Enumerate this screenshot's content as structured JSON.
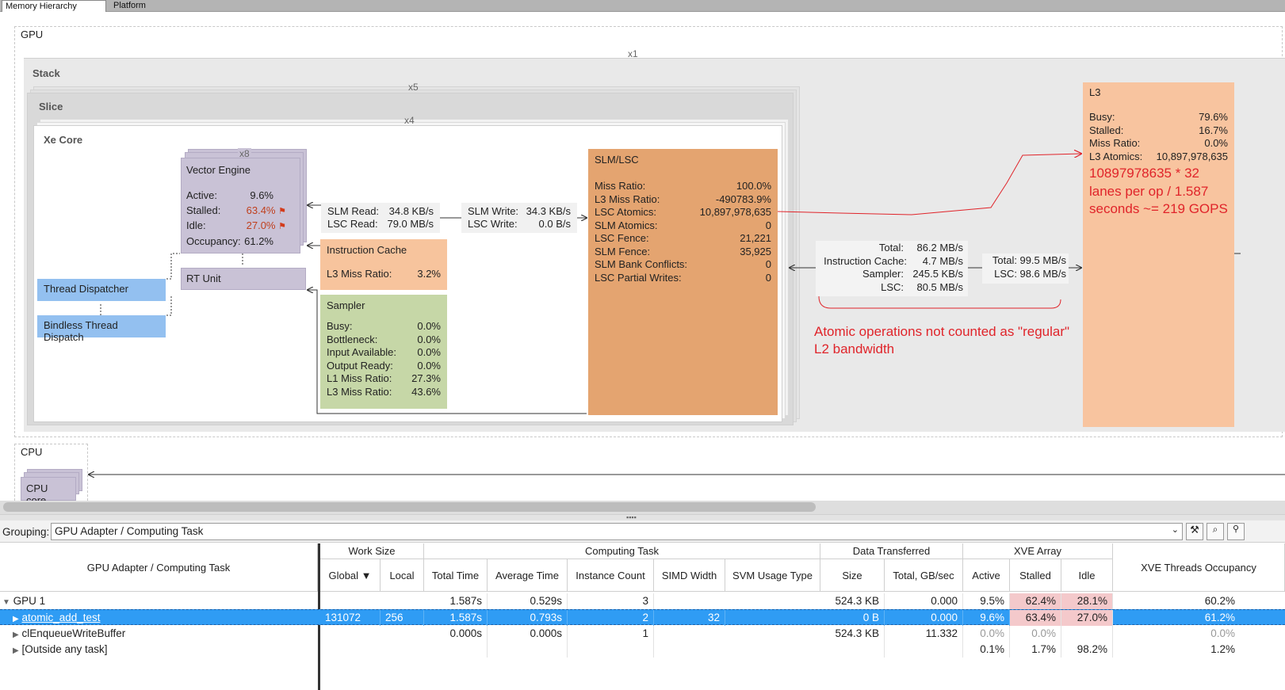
{
  "tabs": [
    {
      "label": "Memory Hierarchy Diagram"
    },
    {
      "label": "Platform"
    }
  ],
  "diagram": {
    "gpu_label": "GPU",
    "gpu_mult": "x1",
    "stack_label": "Stack",
    "stack_mult": "x5",
    "slice_label": "Slice",
    "slice_mult": "x4",
    "xecore_label": "Xe Core",
    "ve_mult": "x8",
    "vector_engine": {
      "title": "Vector Engine",
      "active_label": "Active:",
      "active": "9.6%",
      "stalled_label": "Stalled:",
      "stalled": "63.4%",
      "idle_label": "Idle:",
      "idle": "27.0%",
      "occupancy_label": "Occupancy:",
      "occupancy": "61.2%"
    },
    "rt_unit": "RT Unit",
    "thread_dispatcher": "Thread Dispatcher",
    "bindless_thread_dispatch": "Bindless Thread Dispatch",
    "slm_read_box": {
      "slm_read_label": "SLM Read:",
      "slm_read": "34.8 KB/s",
      "lsc_read_label": "LSC Read:",
      "lsc_read": "79.0 MB/s"
    },
    "slm_write_box": {
      "slm_write_label": "SLM Write:",
      "slm_write": "34.3 KB/s",
      "lsc_write_label": "LSC Write:",
      "lsc_write": "0.0 B/s"
    },
    "instruction_cache": {
      "title": "Instruction Cache",
      "l3_miss_label": "L3 Miss Ratio:",
      "l3_miss": "3.2%"
    },
    "sampler": {
      "title": "Sampler",
      "rows": [
        {
          "label": "Busy:",
          "value": "0.0%"
        },
        {
          "label": "Bottleneck:",
          "value": "0.0%"
        },
        {
          "label": "Input Available:",
          "value": "0.0%"
        },
        {
          "label": "Output Ready:",
          "value": "0.0%"
        },
        {
          "label": "L1 Miss Ratio:",
          "value": "27.3%"
        },
        {
          "label": "L3 Miss Ratio:",
          "value": "43.6%"
        }
      ]
    },
    "slm_lsc": {
      "title": "SLM/LSC",
      "rows": [
        {
          "label": "Miss Ratio:",
          "value": "100.0%"
        },
        {
          "label": "L3 Miss Ratio:",
          "value": "-490783.9%"
        },
        {
          "label": "LSC Atomics:",
          "value": "10,897,978,635"
        },
        {
          "label": "SLM Atomics:",
          "value": "0"
        },
        {
          "label": "LSC Fence:",
          "value": "21,221"
        },
        {
          "label": "SLM Fence:",
          "value": "35,925"
        },
        {
          "label": "SLM Bank Conflicts:",
          "value": "0"
        },
        {
          "label": "LSC Partial Writes:",
          "value": "0"
        }
      ]
    },
    "bandwidth_left": {
      "rows": [
        {
          "label": "Total:",
          "value": "86.2 MB/s"
        },
        {
          "label": "Instruction Cache:",
          "value": "4.7 MB/s"
        },
        {
          "label": "Sampler:",
          "value": "245.5 KB/s"
        },
        {
          "label": "LSC:",
          "value": "80.5 MB/s"
        }
      ]
    },
    "bandwidth_right": {
      "rows": [
        {
          "label": "Total:",
          "value": "99.5 MB/s"
        },
        {
          "label": "LSC:",
          "value": "98.6 MB/s"
        }
      ]
    },
    "l3": {
      "title": "L3",
      "rows": [
        {
          "label": "Busy:",
          "value": "79.6%"
        },
        {
          "label": "Stalled:",
          "value": "16.7%"
        },
        {
          "label": "Miss Ratio:",
          "value": "0.0%"
        },
        {
          "label": "L3 Atomics:",
          "value": "10,897,978,635"
        }
      ]
    },
    "annotation_gops": "10897978635 * 32 lanes per op / 1.587 seconds ~= 219 GOPS",
    "annotation_atomic": "Atomic operations not counted as \"regular\" L2 bandwidth",
    "cpu_label": "CPU",
    "cpu_core": "CPU core"
  },
  "grouping": {
    "label": "Grouping:",
    "value": "GPU Adapter / Computing Task"
  },
  "table": {
    "col_main": "GPU Adapter / Computing Task",
    "groups": {
      "work_size": "Work Size",
      "computing_task": "Computing Task",
      "data_transferred": "Data Transferred",
      "xve_array": "XVE Array"
    },
    "cols": {
      "global": "Global ▼",
      "local": "Local",
      "total_time": "Total Time",
      "average_time": "Average Time",
      "instance_count": "Instance Count",
      "simd_width": "SIMD Width",
      "svm_usage_type": "SVM Usage Type",
      "size": "Size",
      "total_gbs": "Total, GB/sec",
      "active": "Active",
      "stalled": "Stalled",
      "idle": "Idle",
      "occupancy": "XVE Threads Occupancy"
    },
    "rows": [
      {
        "name": "GPU 1",
        "global": "",
        "local": "",
        "total_time": "1.587s",
        "average_time": "0.529s",
        "instance_count": "3",
        "simd_width": "",
        "svm": "",
        "size": "524.3 KB",
        "total_gbs": "0.000",
        "active": "9.5%",
        "stalled": "62.4%",
        "idle": "28.1%",
        "occupancy": "60.2%"
      },
      {
        "name": "atomic_add_test",
        "global": "131072",
        "local": "256",
        "total_time": "1.587s",
        "average_time": "0.793s",
        "instance_count": "2",
        "simd_width": "32",
        "svm": "",
        "size": "0 B",
        "total_gbs": "0.000",
        "active": "9.6%",
        "stalled": "63.4%",
        "idle": "27.0%",
        "occupancy": "61.2%"
      },
      {
        "name": "clEnqueueWriteBuffer",
        "global": "",
        "local": "",
        "total_time": "0.000s",
        "average_time": "0.000s",
        "instance_count": "1",
        "simd_width": "",
        "svm": "",
        "size": "524.3 KB",
        "total_gbs": "11.332",
        "active": "0.0%",
        "stalled": "0.0%",
        "idle": "",
        "occupancy": "0.0%"
      },
      {
        "name": "[Outside any task]",
        "global": "",
        "local": "",
        "total_time": "",
        "average_time": "",
        "instance_count": "",
        "simd_width": "",
        "svm": "",
        "size": "",
        "total_gbs": "",
        "active": "0.1%",
        "stalled": "1.7%",
        "idle": "98.2%",
        "occupancy": "1.2%"
      }
    ]
  },
  "colors": {
    "vector_engine": "#c9c2d6",
    "thread_dispatcher": "#93c0f0",
    "instruction_cache": "#f7c49d",
    "sampler": "#c6d7a7",
    "slm_lsc": "#e4a470",
    "l3": "#f8c49f",
    "annotation_red": "#e0242a",
    "selected_row": "#2f9cf4",
    "pink_cell": "#f4c9cb"
  }
}
